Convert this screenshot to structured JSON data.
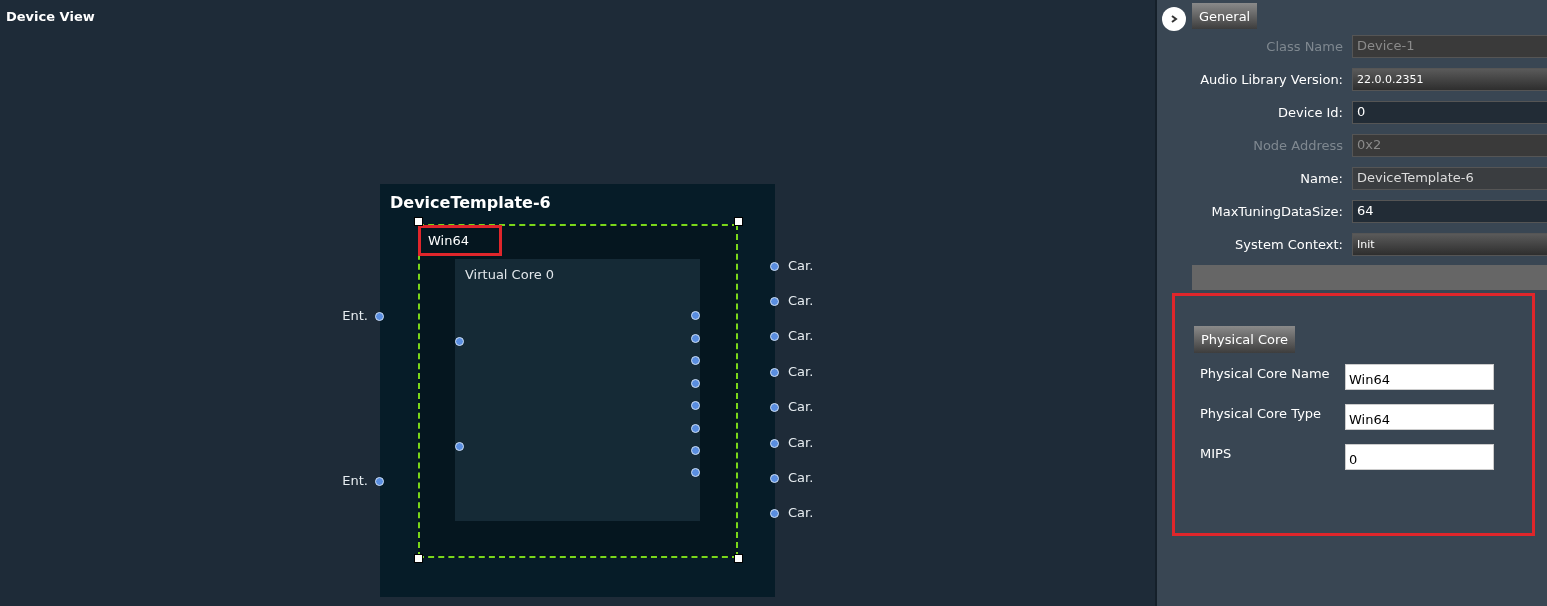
{
  "view": {
    "title": "Device View"
  },
  "device": {
    "name": "DeviceTemplate-6",
    "physical_core": {
      "name": "Win64",
      "selected": true
    },
    "virtual_core": {
      "name": "Virtual Core 0"
    },
    "inputs": [
      "Ent.",
      "Ent."
    ],
    "outputs": [
      "Car.",
      "Car.",
      "Car.",
      "Car.",
      "Car.",
      "Car.",
      "Car.",
      "Car."
    ]
  },
  "properties": {
    "tab": "General",
    "rows": [
      {
        "label": "Class Name",
        "value": "Device-1",
        "kind": "text",
        "disabled": true
      },
      {
        "label": "Audio Library Version:",
        "value": "22.0.0.2351",
        "kind": "combo",
        "disabled": false
      },
      {
        "label": "Device Id:",
        "value": "0",
        "kind": "text",
        "disabled": false
      },
      {
        "label": "Node Address",
        "value": "0x2",
        "kind": "text",
        "disabled": true
      },
      {
        "label": "Name:",
        "value": "DeviceTemplate-6",
        "kind": "readonly",
        "disabled": false
      },
      {
        "label": "MaxTuningDataSize:",
        "value": "64",
        "kind": "text",
        "disabled": false
      },
      {
        "label": "System Context:",
        "value": "Init",
        "kind": "combo",
        "disabled": false
      }
    ]
  },
  "physical_core_panel": {
    "title": "Physical Core",
    "fields": [
      {
        "label": "Physical Core Name",
        "value": "Win64"
      },
      {
        "label": "Physical Core Type",
        "value": "Win64"
      },
      {
        "label": "MIPS",
        "value": "0"
      }
    ]
  }
}
